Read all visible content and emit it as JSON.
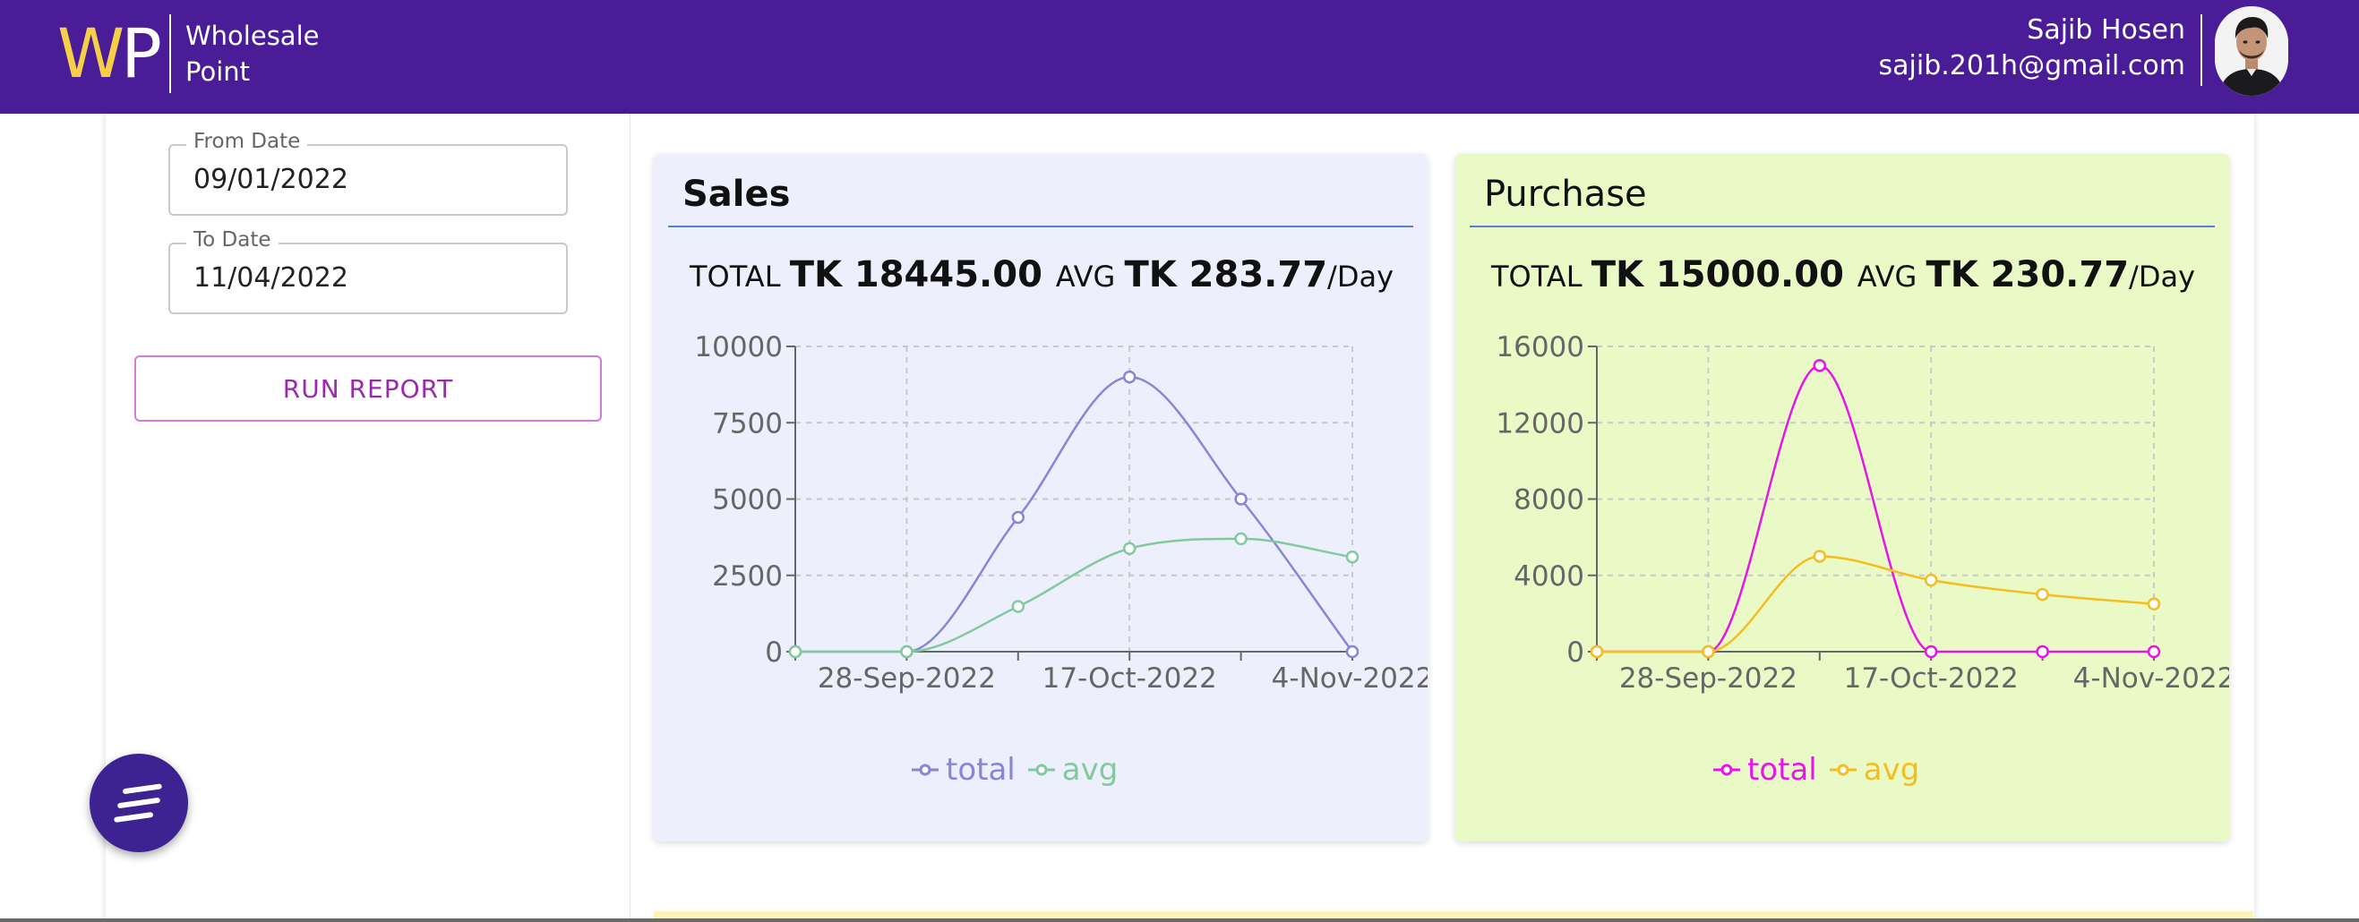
{
  "header": {
    "logo_w": "W",
    "logo_p": "P",
    "brand_line1": "Wholesale",
    "brand_line2": "Point",
    "user_name": "Sajib Hosen",
    "user_email": "sajib.201h@gmail.com"
  },
  "filters": {
    "from_label": "From Date",
    "from_value": "09/01/2022",
    "to_label": "To Date",
    "to_value": "11/04/2022",
    "run_label": "RUN REPORT"
  },
  "sales": {
    "title": "Sales",
    "total_prefix": "TOTAL",
    "total_amount": "TK 18445.00",
    "avg_prefix": "AVG",
    "avg_amount": "TK 283.77",
    "avg_suffix": "/Day",
    "legend_total": "total",
    "legend_avg": "avg",
    "colors": {
      "total": "#8884d8",
      "avg": "#82ca9d",
      "background": "#edf0fc"
    }
  },
  "purchase": {
    "title": "Purchase",
    "total_prefix": "TOTAL",
    "total_amount": "TK 15000.00",
    "avg_prefix": "AVG",
    "avg_amount": "TK 230.77",
    "avg_suffix": "/Day",
    "legend_total": "total",
    "legend_avg": "avg",
    "colors": {
      "total": "#e617e6",
      "avg": "#f5bd1f",
      "background": "#e9fac7"
    }
  },
  "chart_data": [
    {
      "type": "line",
      "x": [
        "",
        "28-Sep-2022",
        "",
        "17-Oct-2022",
        "",
        "4-Nov-2022"
      ],
      "xlabel": "",
      "ylabel": "",
      "ylim": [
        0,
        10000
      ],
      "yticks": [
        0,
        2500,
        5000,
        7500,
        10000
      ],
      "grid": true,
      "legend": "bottom",
      "series": [
        {
          "name": "total",
          "values": [
            0,
            0,
            4400,
            9000,
            5000,
            0
          ]
        },
        {
          "name": "avg",
          "values": [
            0,
            0,
            1480,
            3380,
            3700,
            3100
          ]
        }
      ]
    },
    {
      "type": "line",
      "x": [
        "",
        "28-Sep-2022",
        "",
        "17-Oct-2022",
        "",
        "4-Nov-2022"
      ],
      "xlabel": "",
      "ylabel": "",
      "ylim": [
        0,
        16000
      ],
      "yticks": [
        0,
        4000,
        8000,
        12000,
        16000
      ],
      "grid": true,
      "legend": "bottom",
      "series": [
        {
          "name": "total",
          "values": [
            0,
            0,
            15000,
            0,
            0,
            0
          ]
        },
        {
          "name": "avg",
          "values": [
            0,
            0,
            5000,
            3750,
            3000,
            2500
          ]
        }
      ]
    }
  ]
}
